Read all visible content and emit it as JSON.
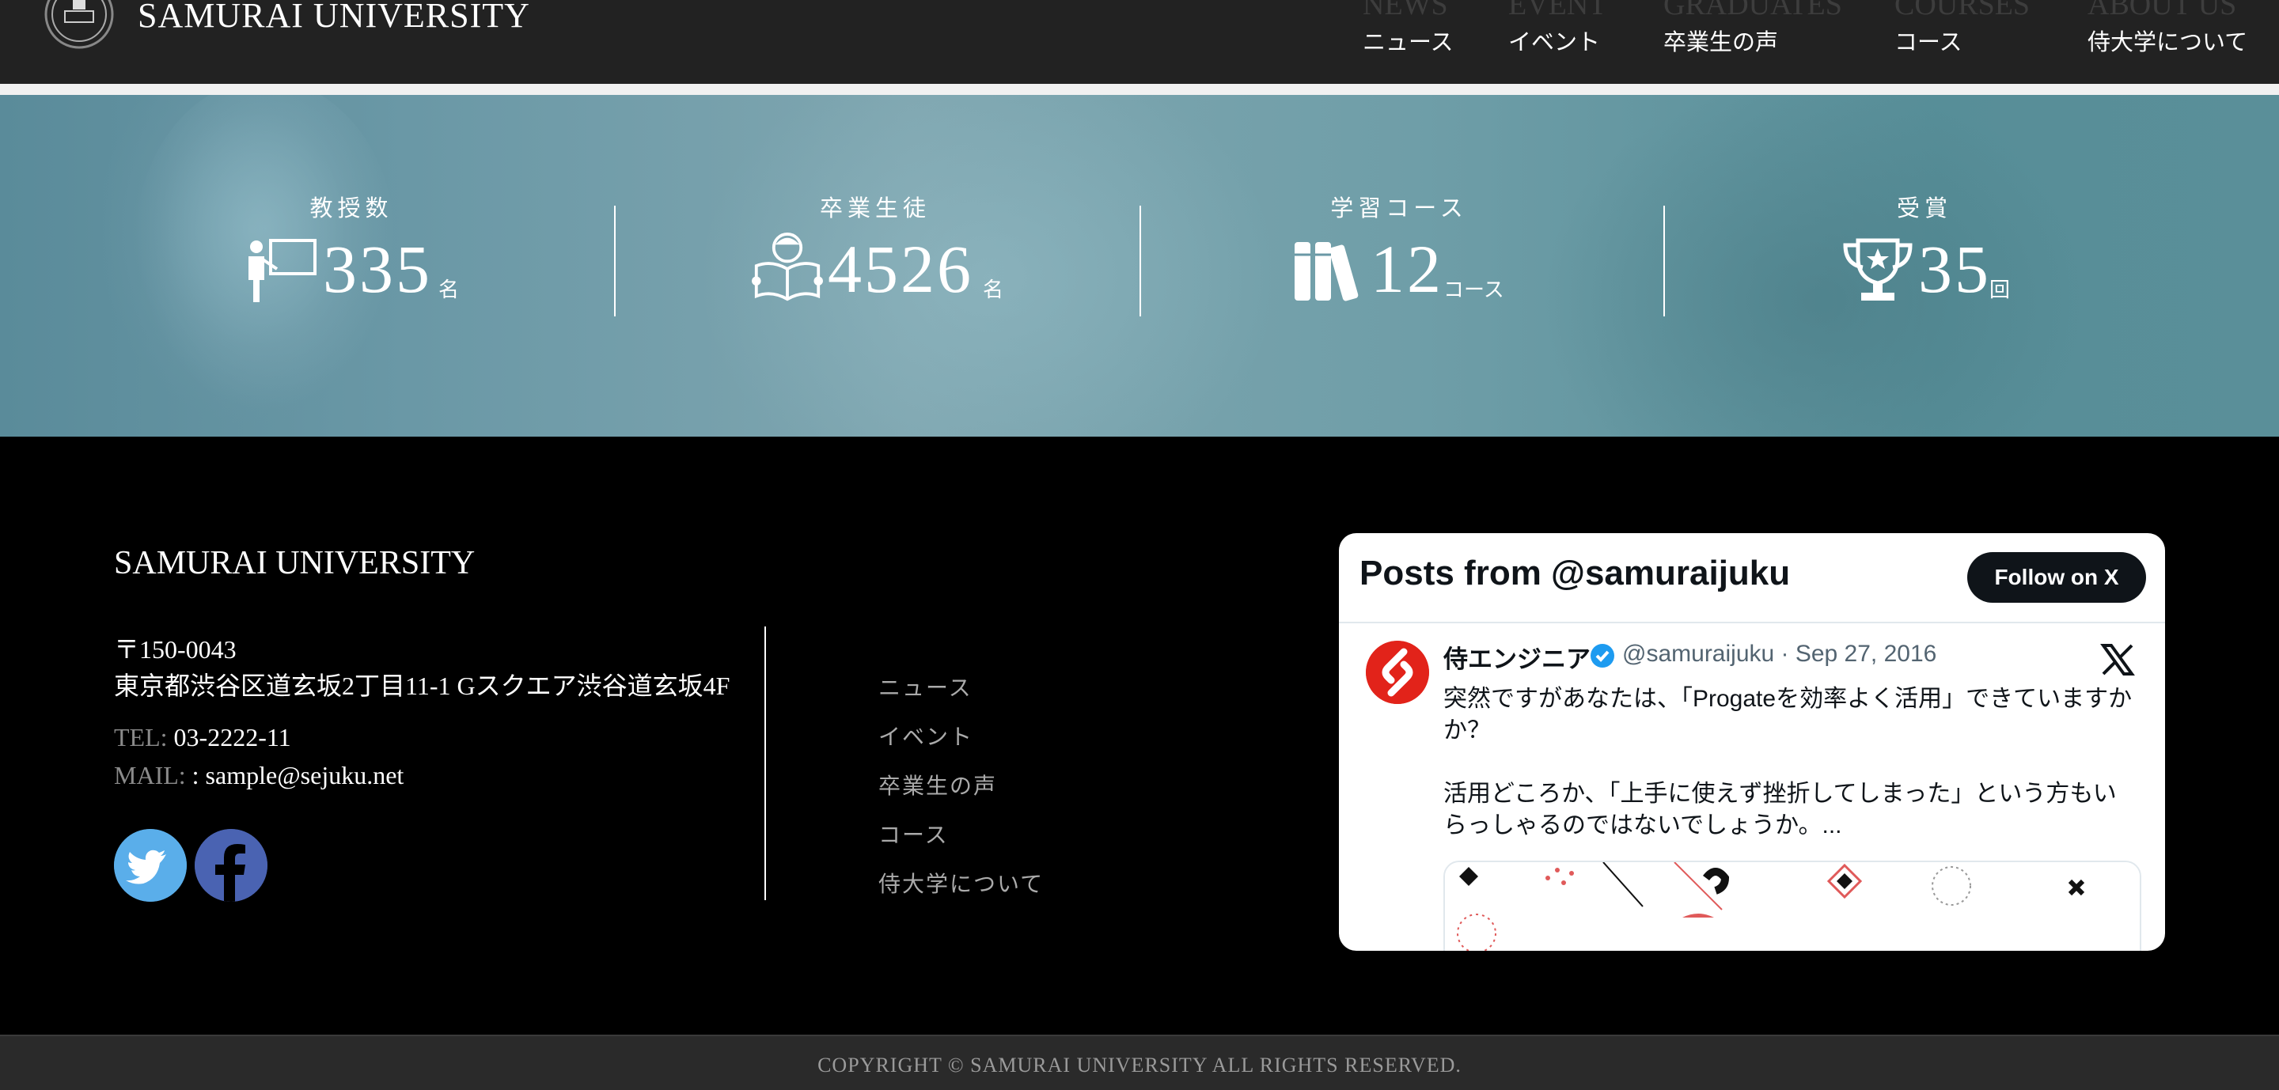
{
  "header": {
    "site_title": "SAMURAI UNIVERSITY",
    "nav": [
      {
        "en": "NEWS",
        "ja": "ニュース"
      },
      {
        "en": "EVENT",
        "ja": "イベント"
      },
      {
        "en": "GRADUATES",
        "ja": "卒業生の声"
      },
      {
        "en": "COURSES",
        "ja": "コース"
      },
      {
        "en": "ABOUT US",
        "ja": "侍大学について"
      }
    ]
  },
  "stats": [
    {
      "label": "教授数",
      "value": "335",
      "unit": "名",
      "icon": "professor-icon"
    },
    {
      "label": "卒業生徒",
      "value": "4526",
      "unit": "名",
      "icon": "graduate-reading-icon"
    },
    {
      "label": "学習コース",
      "value": "12",
      "unit": "コース",
      "icon": "books-icon"
    },
    {
      "label": "受賞",
      "value": "35",
      "unit": "回",
      "icon": "trophy-icon"
    }
  ],
  "footer": {
    "title": "SAMURAI UNIVERSITY",
    "postal": "〒150-0043",
    "address": "東京都渋谷区道玄坂2丁目11-1 Gスクエア渋谷道玄坂4F",
    "tel_label": "TEL:",
    "tel": "03-2222-11",
    "mail_label": "MAIL:",
    "mail": ": sample@sejuku.net",
    "nav": [
      "ニュース",
      "イベント",
      "卒業生の声",
      "コース",
      "侍大学について"
    ],
    "copyright": "COPYRIGHT © SAMURAI UNIVERSITY ALL RIGHTS RESERVED."
  },
  "timeline": {
    "title": "Posts from @samuraijuku",
    "follow_label": "Follow on X",
    "author": "侍エンジニア",
    "handle_date": "@samuraijuku · Sep 27, 2016",
    "lines": [
      "突然ですがあなたは、「Progateを効率よく活用」できていますか",
      "か？",
      "活用どころか、「上手に使えず挫折してしまった」という方もい",
      "らっしゃるのではないでしょうか。..."
    ]
  },
  "colors": {
    "header_bg": "#222222",
    "footer_bg": "#000000",
    "twitter": "#5aaeea",
    "facebook": "#4a63b2",
    "brand_red": "#e2231a"
  }
}
